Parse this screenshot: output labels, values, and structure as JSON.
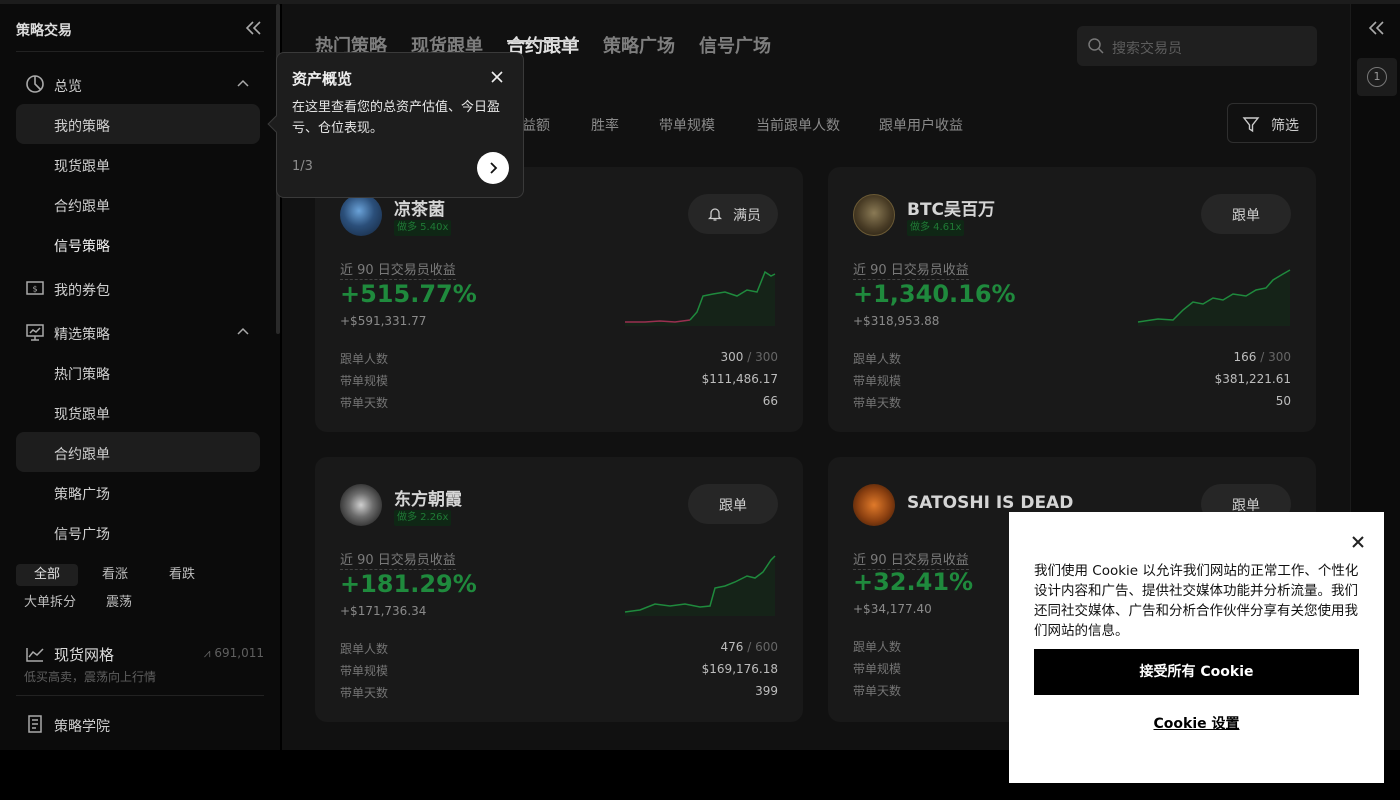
{
  "sidebar": {
    "title": "策略交易",
    "overview": "总览",
    "my_strategy": "我的策略",
    "spot_copy": "现货跟单",
    "futures_copy": "合约跟单",
    "signal_strategy": "信号策略",
    "coupons": "我的券包",
    "featured": "精选策略",
    "hot": "热门策略",
    "spot_copy2": "现货跟单",
    "futures_copy2": "合约跟单",
    "plaza": "策略广场",
    "signal_plaza": "信号广场",
    "chips": [
      "全部",
      "看涨",
      "看跌",
      "大单拆分",
      "震荡"
    ],
    "grid": {
      "title": "现货网格",
      "subtitle": "低买高卖，震荡向上行情",
      "users": "691,011"
    },
    "academy": "策略学院"
  },
  "main": {
    "tabs": [
      "热门策略",
      "现货跟单",
      "合约跟单",
      "策略广场",
      "信号广场"
    ],
    "active_tab": "合约跟单",
    "search_placeholder": "搜索交易员",
    "sorts": [
      "益额",
      "胜率",
      "带单规模",
      "当前跟单人数",
      "跟单用户收益"
    ],
    "filter": "筛选",
    "stat_labels": {
      "followers": "跟单人数",
      "aum": "带单规模",
      "days": "带单天数",
      "pnl_label": "近 90 日交易员收益"
    },
    "cards": [
      {
        "name": "凉茶菌",
        "badge": "做多 5.40x",
        "button": "满员",
        "pct": "+515.77%",
        "usd": "+$591,331.77",
        "followers": "300",
        "followers_max": "/ 300",
        "aum": "$111,486.17",
        "days": "66"
      },
      {
        "name": "BTC吴百万",
        "badge": "做多 4.61x",
        "button": "跟单",
        "pct": "+1,340.16%",
        "usd": "+$318,953.88",
        "followers": "166",
        "followers_max": "/ 300",
        "aum": "$381,221.61",
        "days": "50"
      },
      {
        "name": "东方朝霞",
        "badge": "做多 2.26x",
        "button": "跟单",
        "pct": "+181.29%",
        "usd": "+$171,736.34",
        "followers": "476",
        "followers_max": "/ 600",
        "aum": "$169,176.18",
        "days": "399"
      },
      {
        "name": "SATOSHI IS DEAD",
        "badge": "",
        "button": "跟单",
        "pct": "+32.41%",
        "usd": "+$34,177.40",
        "followers": "",
        "followers_max": "",
        "aum": "",
        "days": ""
      }
    ]
  },
  "rail": {
    "badge": "1"
  },
  "tour": {
    "title": "资产概览",
    "body": "在这里查看您的总资产估值、今日盈亏、仓位表现。",
    "step": "1/3"
  },
  "cookie": {
    "text": "我们使用 Cookie 以允许我们网站的正常工作、个性化设计内容和广告、提供社交媒体功能并分析流量。我们还同社交媒体、广告和分析合作伙伴分享有关您使用我们网站的信息。",
    "accept": "接受所有 Cookie",
    "settings": "Cookie 设置"
  },
  "colors": {
    "profit": "#1f8a3d",
    "background": "#111111",
    "card": "#191919"
  }
}
